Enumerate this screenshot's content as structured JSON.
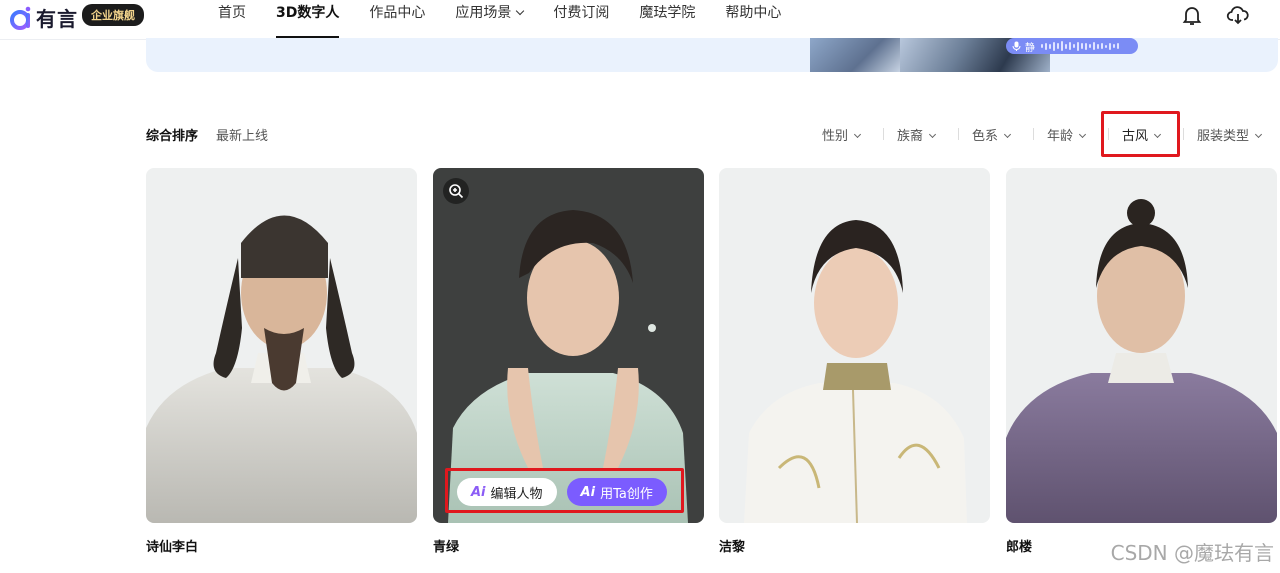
{
  "header": {
    "logo_text": "有言",
    "enterprise_badge": "企业旗舰",
    "nav": [
      {
        "label": "首页"
      },
      {
        "label": "3D数字人"
      },
      {
        "label": "作品中心"
      },
      {
        "label": "应用场景"
      },
      {
        "label": "付费订阅"
      },
      {
        "label": "魔珐学院"
      },
      {
        "label": "帮助中心"
      }
    ],
    "icons": [
      "bell-icon",
      "cloud-download-icon"
    ]
  },
  "banner": {
    "voice_text": "静"
  },
  "sort": {
    "options": [
      {
        "label": "综合排序"
      },
      {
        "label": "最新上线"
      }
    ]
  },
  "filters": [
    {
      "label": "性别"
    },
    {
      "label": "族裔"
    },
    {
      "label": "色系"
    },
    {
      "label": "年龄"
    },
    {
      "label": "古风"
    },
    {
      "label": "服装类型"
    }
  ],
  "characters": [
    {
      "name": "诗仙李白"
    },
    {
      "name": "青绿",
      "actions": {
        "edit": "编辑人物",
        "create": "用Ta创作",
        "ai_mark": "Ai"
      }
    },
    {
      "name": "洁黎"
    },
    {
      "name": "郎楼"
    }
  ],
  "colors": {
    "accent": "#7b5cff",
    "highlight_box": "#e0181e",
    "badge_bg": "#1c1c1c",
    "badge_text": "#f3d48c"
  },
  "watermark": "CSDN @魔珐有言"
}
